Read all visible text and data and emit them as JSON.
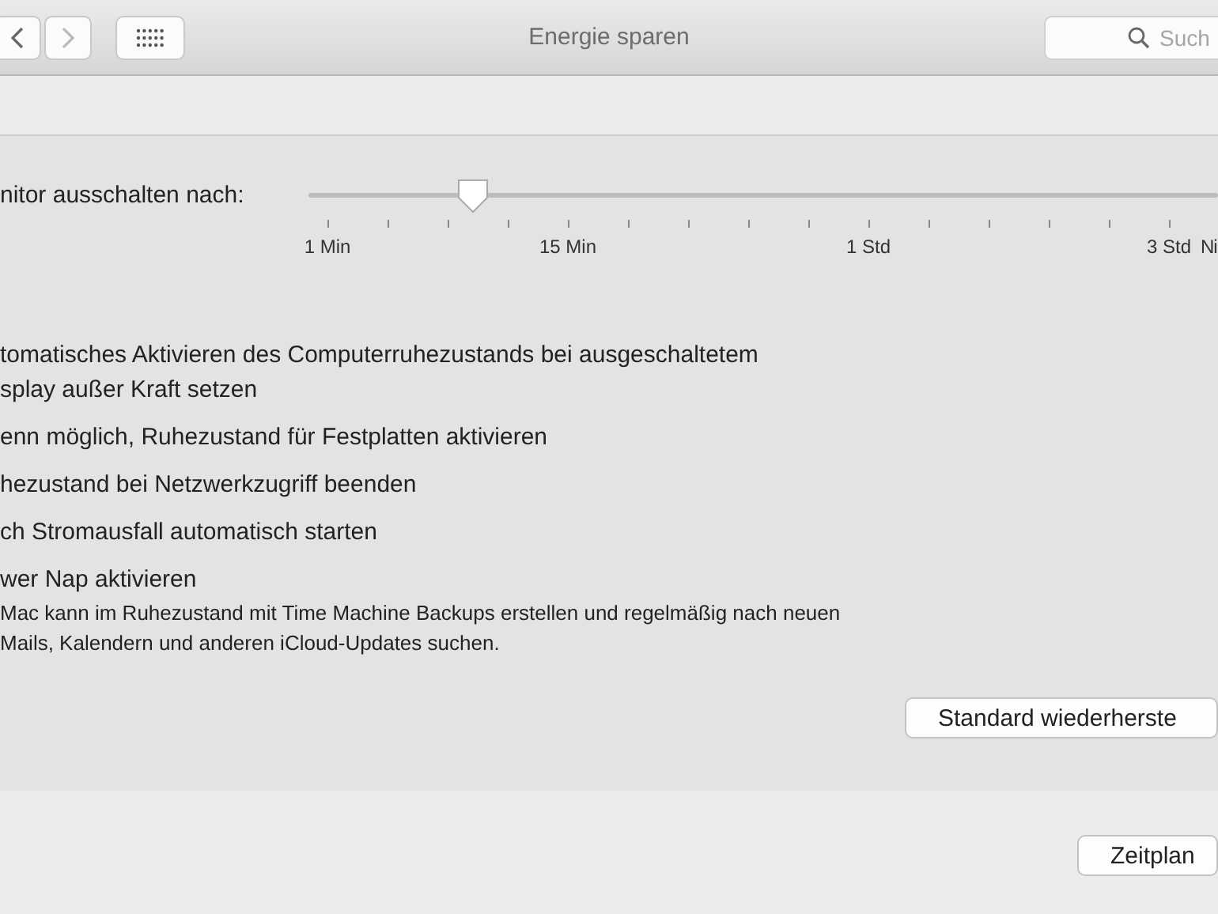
{
  "window": {
    "title": "Energie sparen"
  },
  "search": {
    "placeholder": "Such"
  },
  "slider": {
    "label": "nitor ausschalten nach:",
    "level": 0.18,
    "tick_labels": [
      "1 Min",
      "15 Min",
      "1 Std",
      "3 Std",
      "Ni"
    ]
  },
  "options": [
    {
      "lines": [
        "tomatisches Aktivieren des Computerruhezustands bei ausgeschaltetem",
        "splay außer Kraft setzen"
      ]
    },
    {
      "lines": [
        "enn möglich, Ruhezustand für Festplatten aktivieren"
      ]
    },
    {
      "lines": [
        "hezustand bei Netzwerkzugriff beenden"
      ]
    },
    {
      "lines": [
        "ch Stromausfall automatisch starten"
      ]
    },
    {
      "lines": [
        "wer Nap aktivieren"
      ],
      "description": [
        "Mac kann im Ruhezustand mit Time Machine Backups erstellen und regelmäßig nach neuen",
        "Mails, Kalendern und anderen iCloud-Updates suchen."
      ]
    }
  ],
  "buttons": {
    "restore": "Standard wiederherste",
    "schedule": "Zeitplan"
  }
}
